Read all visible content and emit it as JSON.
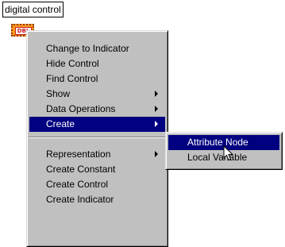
{
  "control_label": "digital control",
  "terminal_badge": "DBL",
  "context_menu": {
    "items_top": [
      {
        "label": "Change to Indicator",
        "has_submenu": false
      },
      {
        "label": "Hide Control",
        "has_submenu": false
      },
      {
        "label": "Find Control",
        "has_submenu": false
      },
      {
        "label": "Show",
        "has_submenu": true
      },
      {
        "label": "Data Operations",
        "has_submenu": true
      },
      {
        "label": "Create",
        "has_submenu": true,
        "selected": true
      }
    ],
    "items_bottom": [
      {
        "label": "Representation",
        "has_submenu": true
      },
      {
        "label": "Create Constant",
        "has_submenu": false
      },
      {
        "label": "Create Control",
        "has_submenu": false
      },
      {
        "label": "Create Indicator",
        "has_submenu": false
      }
    ]
  },
  "create_submenu": {
    "items": [
      {
        "label": "Attribute Node",
        "selected": true
      },
      {
        "label": "Local Variable",
        "selected": false
      }
    ]
  },
  "colors": {
    "menu_background": "#c0c0c0",
    "selection_background": "#000080",
    "terminal_orange": "#ff9a1f",
    "terminal_text_red": "#c81e1e"
  }
}
